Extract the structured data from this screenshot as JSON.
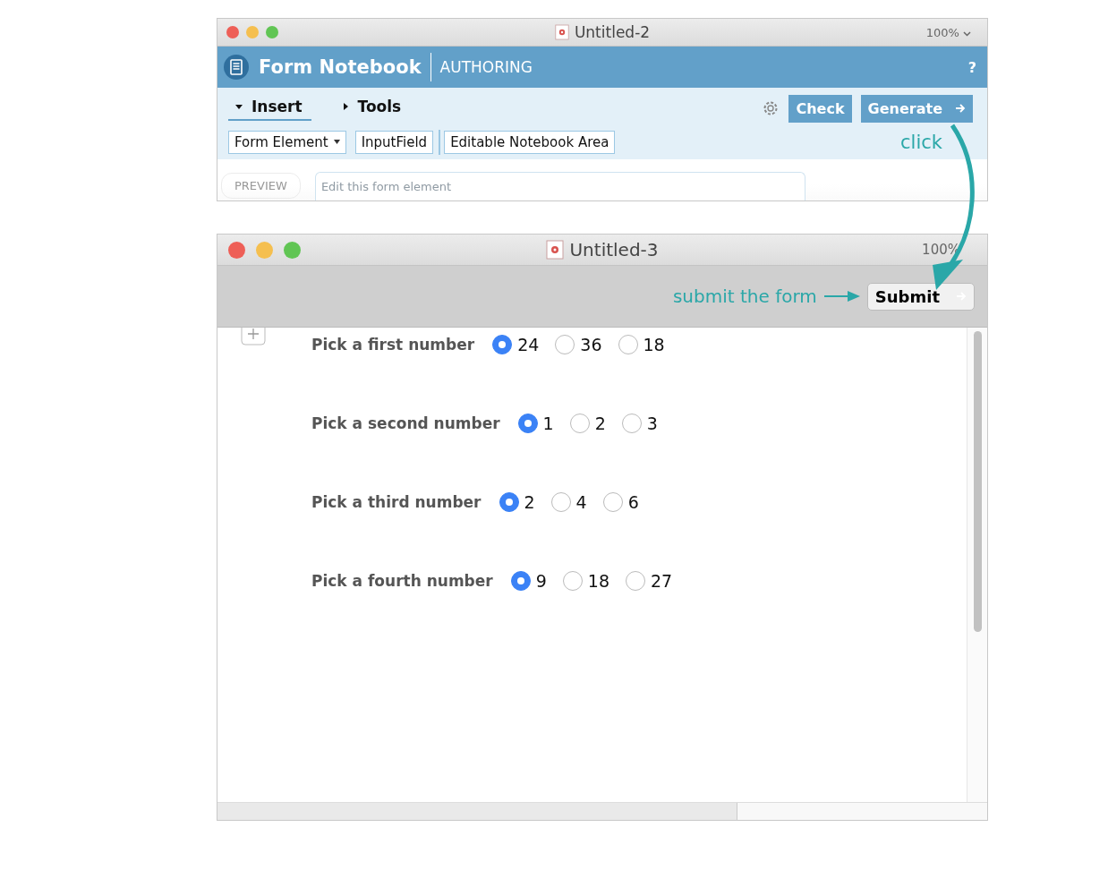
{
  "window_back": {
    "title": "Untitled-2",
    "zoom": "100%",
    "app_name": "Form Notebook",
    "mode": "AUTHORING",
    "help": "?",
    "tabs": [
      {
        "label": "Insert",
        "selected": true
      },
      {
        "label": "Tools",
        "selected": false
      }
    ],
    "buttons": [
      "Check",
      "Generate"
    ],
    "elements": [
      {
        "label": "Form Element",
        "kind": "dropdown"
      },
      {
        "label": "InputField",
        "kind": "button"
      },
      {
        "label": "Editable Notebook Area",
        "kind": "button"
      }
    ],
    "preview": {
      "label": "PREVIEW",
      "placeholder": "Edit this form element"
    }
  },
  "window_front": {
    "title": "Untitled-3",
    "zoom": "100%",
    "submit": "Submit",
    "questions": [
      {
        "label": "Pick a first number",
        "options": [
          {
            "label": "24",
            "selected": true
          },
          {
            "label": "36",
            "selected": false
          },
          {
            "label": "18",
            "selected": false
          }
        ]
      },
      {
        "label": "Pick a second number",
        "options": [
          {
            "label": "1",
            "selected": true
          },
          {
            "label": "2",
            "selected": false
          },
          {
            "label": "3",
            "selected": false
          }
        ]
      },
      {
        "label": "Pick a third number",
        "options": [
          {
            "label": "2",
            "selected": true
          },
          {
            "label": "4",
            "selected": false
          },
          {
            "label": "6",
            "selected": false
          }
        ]
      },
      {
        "label": "Pick a fourth number",
        "options": [
          {
            "label": "9",
            "selected": true
          },
          {
            "label": "18",
            "selected": false
          },
          {
            "label": "27",
            "selected": false
          }
        ]
      }
    ]
  },
  "annotations": {
    "click": "click",
    "submit_hint": "submit the form"
  }
}
